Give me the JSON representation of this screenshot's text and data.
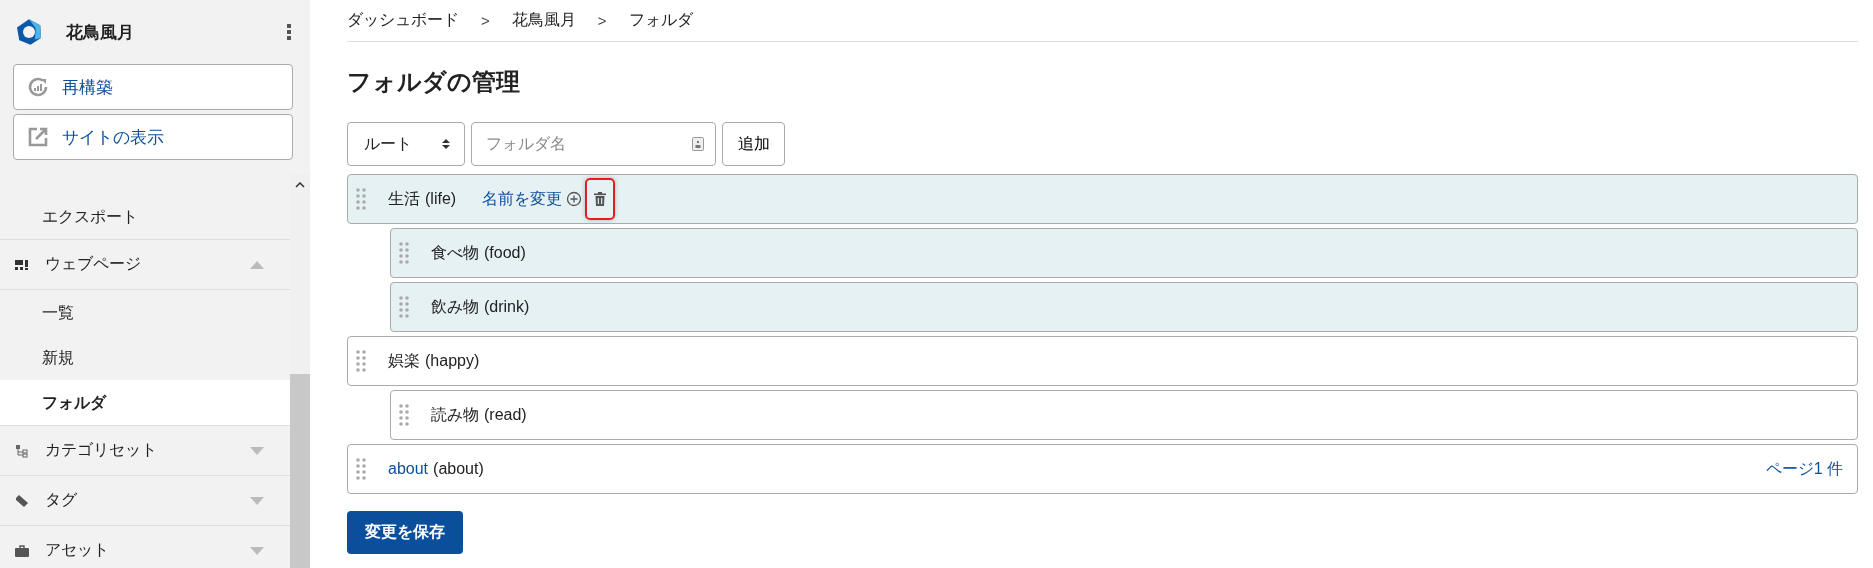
{
  "sidebar": {
    "site_name": "花鳥風月",
    "buttons": [
      {
        "label": "再構築"
      },
      {
        "label": "サイトの表示"
      }
    ],
    "items": [
      {
        "kind": "sub",
        "label": "エクスポート",
        "selected": false
      },
      {
        "kind": "group",
        "label": "ウェブページ",
        "expanded": true
      },
      {
        "kind": "sub",
        "label": "一覧",
        "selected": false
      },
      {
        "kind": "sub",
        "label": "新規",
        "selected": false
      },
      {
        "kind": "sub",
        "label": "フォルダ",
        "selected": true
      },
      {
        "kind": "group",
        "label": "カテゴリセット",
        "expanded": false
      },
      {
        "kind": "group",
        "label": "タグ",
        "expanded": false
      },
      {
        "kind": "group",
        "label": "アセット",
        "expanded": false
      }
    ]
  },
  "breadcrumb": [
    {
      "kind": "link",
      "text": "ダッシュボード"
    },
    {
      "kind": "sep",
      "text": ">"
    },
    {
      "kind": "link",
      "text": "花鳥風月"
    },
    {
      "kind": "sep",
      "text": ">"
    },
    {
      "kind": "link",
      "text": "フォルダ"
    }
  ],
  "title": "フォルダの管理",
  "form": {
    "parent": "ルート",
    "placeholder": "フォルダ名",
    "add_button": "追加"
  },
  "folders": [
    {
      "name": "生活",
      "slug": "(life)",
      "linked": false,
      "highlighted": true,
      "rename": "名前を変更",
      "delete_focused": true,
      "children": [
        {
          "name": "食べ物",
          "slug": "(food)",
          "linked": false,
          "highlighted": true
        },
        {
          "name": "飲み物",
          "slug": "(drink)",
          "linked": false,
          "highlighted": true
        }
      ]
    },
    {
      "name": "娯楽",
      "slug": "(happy)",
      "linked": false,
      "highlighted": false,
      "children": [
        {
          "name": "読み物",
          "slug": "(read)",
          "linked": false,
          "highlighted": false
        }
      ]
    },
    {
      "name": "about",
      "slug": "(about)",
      "linked": true,
      "highlighted": false,
      "page_count": "ページ1 件"
    }
  ],
  "save_button": "変更を保存"
}
